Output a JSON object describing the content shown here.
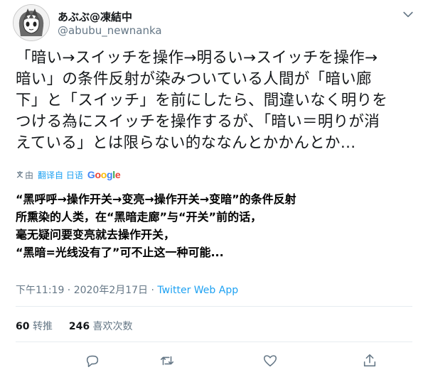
{
  "user": {
    "display_name": "あぶぶ@凍結中",
    "handle": "@abubu_newnanka",
    "avatar_icon": "anime-girl-avatar"
  },
  "tweet": {
    "text": "「暗い→スイッチを操作→明るい→スイッチを操作→\n暗い」の条件反射が染みついている人間が「暗い廊\n下」と「スイッチ」を前にしたら、間違いなく明りを\nつける為にスイッチを操作するが、「暗い＝明りが消\nえている」とは限らない的ななんとかかんとか…"
  },
  "translation": {
    "label_prefix": "由",
    "label_action": "翻译自 日语",
    "provider": [
      "G",
      "o",
      "o",
      "g",
      "l",
      "e"
    ],
    "lines": [
      " “黑呼呼→操作开关→变亮→操作开关→变暗”的条件反射",
      "所熏染的人类，在“黑暗走廊”与“开关”前的话，",
      "毫无疑问要变亮就去操作开关，",
      " “黑暗=光线没有了”可不止这一种可能..."
    ]
  },
  "meta": {
    "time": "下午11:19 · 2020年2月17日 · ",
    "app": "Twitter Web App"
  },
  "stats": {
    "retweets_count": "60",
    "retweets_label": "转推",
    "likes_count": "246",
    "likes_label": "喜欢次数"
  },
  "colors": {
    "accent": "#1da1f2",
    "secondary_text": "#657786",
    "divider": "#e6ecf0"
  }
}
